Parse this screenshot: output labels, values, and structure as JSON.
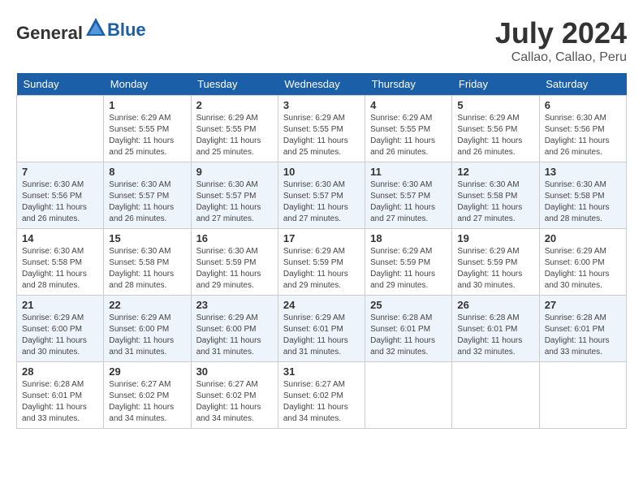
{
  "header": {
    "logo_general": "General",
    "logo_blue": "Blue",
    "title": "July 2024",
    "location": "Callao, Callao, Peru"
  },
  "days_of_week": [
    "Sunday",
    "Monday",
    "Tuesday",
    "Wednesday",
    "Thursday",
    "Friday",
    "Saturday"
  ],
  "weeks": [
    [
      {
        "day": "",
        "sunrise": "",
        "sunset": "",
        "daylight": ""
      },
      {
        "day": "1",
        "sunrise": "Sunrise: 6:29 AM",
        "sunset": "Sunset: 5:55 PM",
        "daylight": "Daylight: 11 hours and 25 minutes."
      },
      {
        "day": "2",
        "sunrise": "Sunrise: 6:29 AM",
        "sunset": "Sunset: 5:55 PM",
        "daylight": "Daylight: 11 hours and 25 minutes."
      },
      {
        "day": "3",
        "sunrise": "Sunrise: 6:29 AM",
        "sunset": "Sunset: 5:55 PM",
        "daylight": "Daylight: 11 hours and 25 minutes."
      },
      {
        "day": "4",
        "sunrise": "Sunrise: 6:29 AM",
        "sunset": "Sunset: 5:55 PM",
        "daylight": "Daylight: 11 hours and 26 minutes."
      },
      {
        "day": "5",
        "sunrise": "Sunrise: 6:29 AM",
        "sunset": "Sunset: 5:56 PM",
        "daylight": "Daylight: 11 hours and 26 minutes."
      },
      {
        "day": "6",
        "sunrise": "Sunrise: 6:30 AM",
        "sunset": "Sunset: 5:56 PM",
        "daylight": "Daylight: 11 hours and 26 minutes."
      }
    ],
    [
      {
        "day": "7",
        "sunrise": "Sunrise: 6:30 AM",
        "sunset": "Sunset: 5:56 PM",
        "daylight": "Daylight: 11 hours and 26 minutes."
      },
      {
        "day": "8",
        "sunrise": "Sunrise: 6:30 AM",
        "sunset": "Sunset: 5:57 PM",
        "daylight": "Daylight: 11 hours and 26 minutes."
      },
      {
        "day": "9",
        "sunrise": "Sunrise: 6:30 AM",
        "sunset": "Sunset: 5:57 PM",
        "daylight": "Daylight: 11 hours and 27 minutes."
      },
      {
        "day": "10",
        "sunrise": "Sunrise: 6:30 AM",
        "sunset": "Sunset: 5:57 PM",
        "daylight": "Daylight: 11 hours and 27 minutes."
      },
      {
        "day": "11",
        "sunrise": "Sunrise: 6:30 AM",
        "sunset": "Sunset: 5:57 PM",
        "daylight": "Daylight: 11 hours and 27 minutes."
      },
      {
        "day": "12",
        "sunrise": "Sunrise: 6:30 AM",
        "sunset": "Sunset: 5:58 PM",
        "daylight": "Daylight: 11 hours and 27 minutes."
      },
      {
        "day": "13",
        "sunrise": "Sunrise: 6:30 AM",
        "sunset": "Sunset: 5:58 PM",
        "daylight": "Daylight: 11 hours and 28 minutes."
      }
    ],
    [
      {
        "day": "14",
        "sunrise": "Sunrise: 6:30 AM",
        "sunset": "Sunset: 5:58 PM",
        "daylight": "Daylight: 11 hours and 28 minutes."
      },
      {
        "day": "15",
        "sunrise": "Sunrise: 6:30 AM",
        "sunset": "Sunset: 5:58 PM",
        "daylight": "Daylight: 11 hours and 28 minutes."
      },
      {
        "day": "16",
        "sunrise": "Sunrise: 6:30 AM",
        "sunset": "Sunset: 5:59 PM",
        "daylight": "Daylight: 11 hours and 29 minutes."
      },
      {
        "day": "17",
        "sunrise": "Sunrise: 6:29 AM",
        "sunset": "Sunset: 5:59 PM",
        "daylight": "Daylight: 11 hours and 29 minutes."
      },
      {
        "day": "18",
        "sunrise": "Sunrise: 6:29 AM",
        "sunset": "Sunset: 5:59 PM",
        "daylight": "Daylight: 11 hours and 29 minutes."
      },
      {
        "day": "19",
        "sunrise": "Sunrise: 6:29 AM",
        "sunset": "Sunset: 5:59 PM",
        "daylight": "Daylight: 11 hours and 30 minutes."
      },
      {
        "day": "20",
        "sunrise": "Sunrise: 6:29 AM",
        "sunset": "Sunset: 6:00 PM",
        "daylight": "Daylight: 11 hours and 30 minutes."
      }
    ],
    [
      {
        "day": "21",
        "sunrise": "Sunrise: 6:29 AM",
        "sunset": "Sunset: 6:00 PM",
        "daylight": "Daylight: 11 hours and 30 minutes."
      },
      {
        "day": "22",
        "sunrise": "Sunrise: 6:29 AM",
        "sunset": "Sunset: 6:00 PM",
        "daylight": "Daylight: 11 hours and 31 minutes."
      },
      {
        "day": "23",
        "sunrise": "Sunrise: 6:29 AM",
        "sunset": "Sunset: 6:00 PM",
        "daylight": "Daylight: 11 hours and 31 minutes."
      },
      {
        "day": "24",
        "sunrise": "Sunrise: 6:29 AM",
        "sunset": "Sunset: 6:01 PM",
        "daylight": "Daylight: 11 hours and 31 minutes."
      },
      {
        "day": "25",
        "sunrise": "Sunrise: 6:28 AM",
        "sunset": "Sunset: 6:01 PM",
        "daylight": "Daylight: 11 hours and 32 minutes."
      },
      {
        "day": "26",
        "sunrise": "Sunrise: 6:28 AM",
        "sunset": "Sunset: 6:01 PM",
        "daylight": "Daylight: 11 hours and 32 minutes."
      },
      {
        "day": "27",
        "sunrise": "Sunrise: 6:28 AM",
        "sunset": "Sunset: 6:01 PM",
        "daylight": "Daylight: 11 hours and 33 minutes."
      }
    ],
    [
      {
        "day": "28",
        "sunrise": "Sunrise: 6:28 AM",
        "sunset": "Sunset: 6:01 PM",
        "daylight": "Daylight: 11 hours and 33 minutes."
      },
      {
        "day": "29",
        "sunrise": "Sunrise: 6:27 AM",
        "sunset": "Sunset: 6:02 PM",
        "daylight": "Daylight: 11 hours and 34 minutes."
      },
      {
        "day": "30",
        "sunrise": "Sunrise: 6:27 AM",
        "sunset": "Sunset: 6:02 PM",
        "daylight": "Daylight: 11 hours and 34 minutes."
      },
      {
        "day": "31",
        "sunrise": "Sunrise: 6:27 AM",
        "sunset": "Sunset: 6:02 PM",
        "daylight": "Daylight: 11 hours and 34 minutes."
      },
      {
        "day": "",
        "sunrise": "",
        "sunset": "",
        "daylight": ""
      },
      {
        "day": "",
        "sunrise": "",
        "sunset": "",
        "daylight": ""
      },
      {
        "day": "",
        "sunrise": "",
        "sunset": "",
        "daylight": ""
      }
    ]
  ]
}
